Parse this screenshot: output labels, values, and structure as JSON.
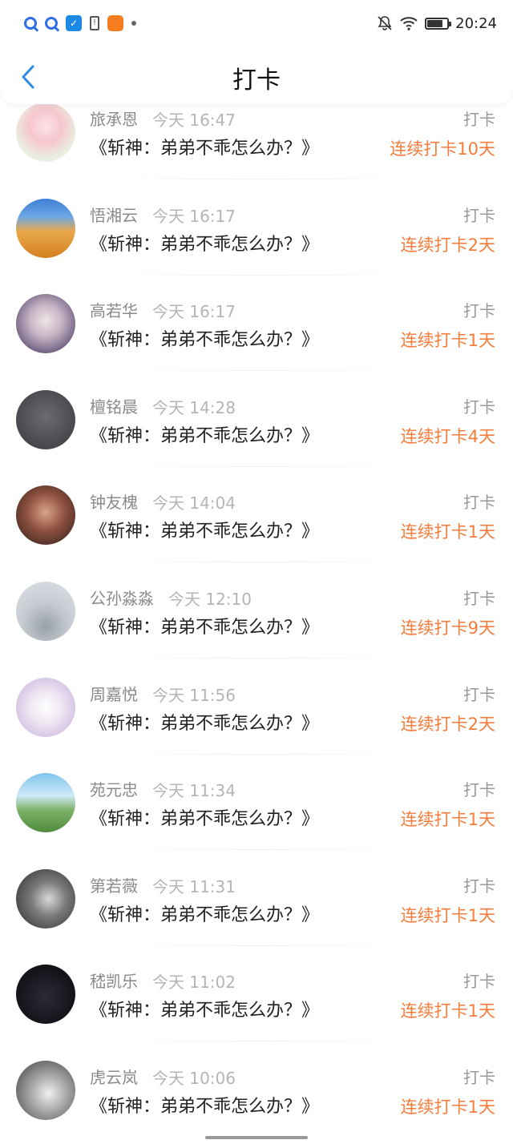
{
  "status_bar": {
    "time": "20:24",
    "battery_level": 0.8,
    "icons": [
      "q-app-icon",
      "q-app-icon",
      "shield-icon",
      "sim-alert-icon",
      "orange-app-icon",
      "notification-dot-icon",
      "bell-muted-icon",
      "wifi-icon",
      "battery-icon"
    ]
  },
  "header": {
    "title": "打卡",
    "back_icon": "chevron-left-icon",
    "accent_color": "#2f8ae6"
  },
  "colors": {
    "streak": "#f57c3a",
    "name": "#8a8a8a",
    "time": "#b5b5b5"
  },
  "entries": [
    {
      "name": "旅承恩",
      "time": "今天 16:47",
      "book": "《斩神：弟弟不乖怎么办？》",
      "action": "打卡",
      "streak": "连续打卡10天",
      "avatar": "anime-girl-avatar"
    },
    {
      "name": "悟湘云",
      "time": "今天 16:17",
      "book": "《斩神：弟弟不乖怎么办？》",
      "action": "打卡",
      "streak": "连续打卡2天",
      "avatar": "desert-camels-avatar"
    },
    {
      "name": "高若华",
      "time": "今天 16:17",
      "book": "《斩神：弟弟不乖怎么办？》",
      "action": "打卡",
      "streak": "连续打卡1天",
      "avatar": "fantasy-character-avatar"
    },
    {
      "name": "檀铭晨",
      "time": "今天 14:28",
      "book": "《斩神：弟弟不乖怎么办？》",
      "action": "打卡",
      "streak": "连续打卡4天",
      "avatar": "gray-figure-avatar"
    },
    {
      "name": "钟友槐",
      "time": "今天 14:04",
      "book": "《斩神：弟弟不乖怎么办？》",
      "action": "打卡",
      "streak": "连续打卡1天",
      "avatar": "woman-portrait-avatar"
    },
    {
      "name": "公孙淼淼",
      "time": "今天 12:10",
      "book": "《斩神：弟弟不乖怎么办？》",
      "action": "打卡",
      "streak": "连续打卡9天",
      "avatar": "girl-face-avatar"
    },
    {
      "name": "周嘉悦",
      "time": "今天 11:56",
      "book": "《斩神：弟弟不乖怎么办？》",
      "action": "打卡",
      "streak": "连续打卡2天",
      "avatar": "cartoon-avatar"
    },
    {
      "name": "苑元忠",
      "time": "今天 11:34",
      "book": "《斩神：弟弟不乖怎么办？》",
      "action": "打卡",
      "streak": "连续打卡1天",
      "avatar": "landscape-avatar"
    },
    {
      "name": "第若薇",
      "time": "今天 11:31",
      "book": "《斩神：弟弟不乖怎么办？》",
      "action": "打卡",
      "streak": "连续打卡1天",
      "avatar": "bw-portrait-avatar"
    },
    {
      "name": "嵇凯乐",
      "time": "今天 11:02",
      "book": "《斩神：弟弟不乖怎么办？》",
      "action": "打卡",
      "streak": "连续打卡1天",
      "avatar": "dark-avatar"
    },
    {
      "name": "虎云岚",
      "time": "今天 10:06",
      "book": "《斩神：弟弟不乖怎么办？》",
      "action": "打卡",
      "streak": "连续打卡1天",
      "avatar": "mono-portrait-avatar"
    }
  ]
}
